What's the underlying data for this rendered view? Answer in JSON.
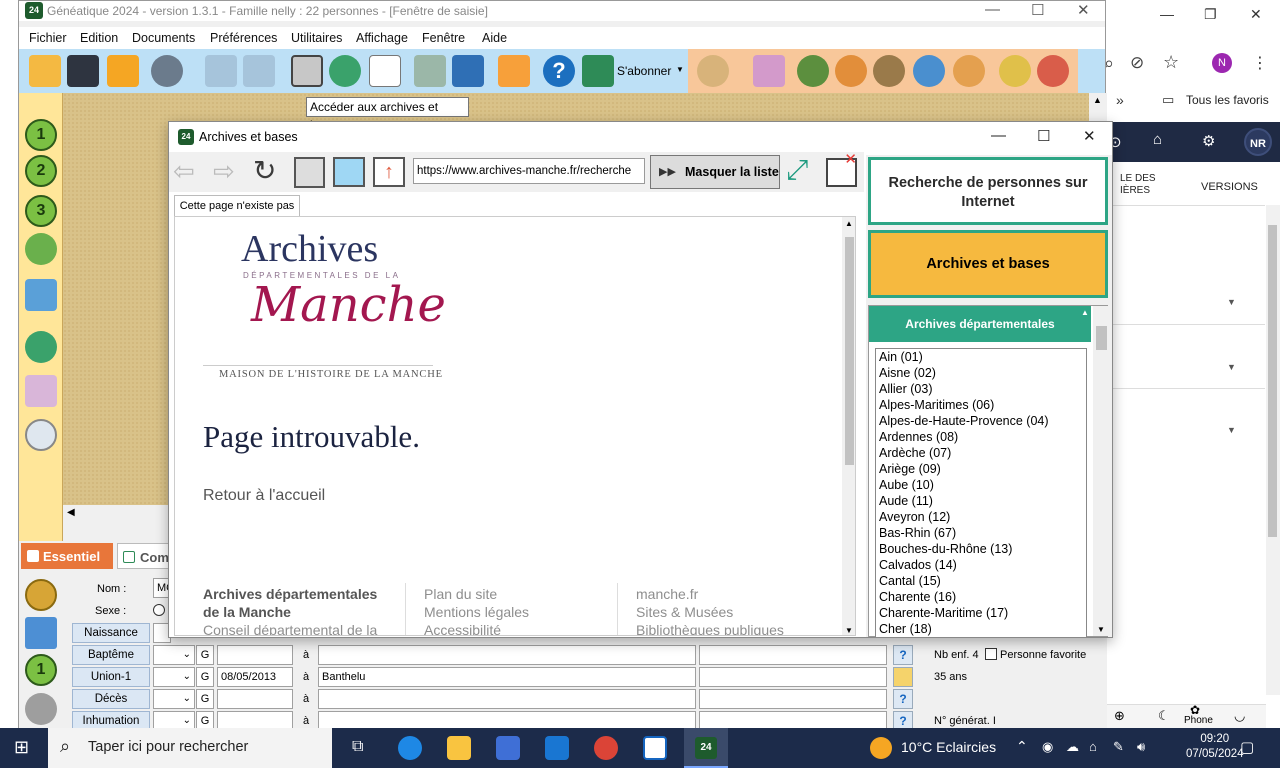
{
  "app": {
    "title": "Généatique 2024 - version 1.3.1 - Famille nelly : 22 personnes - [Fenêtre de saisie]",
    "logo": "24",
    "menu": [
      "Fichier",
      "Edition",
      "Documents",
      "Préférences",
      "Utilitaires",
      "Affichage",
      "Fenêtre",
      "Aide"
    ],
    "toolbar_label": "S'abonner",
    "tooltip": "Accéder aux archives et bases",
    "accent": "#2da585"
  },
  "form": {
    "tabs": [
      "Essentiel",
      "Com"
    ],
    "nom_label": "Nom :",
    "nom_value": "MO",
    "sexe_label": "Sexe :",
    "events": [
      {
        "label": "Naissance",
        "g": "",
        "date": "",
        "a": "",
        "place": ""
      },
      {
        "label": "Baptême",
        "g": "G",
        "date": "",
        "a": "à",
        "place": ""
      },
      {
        "label": "Union-1",
        "g": "G",
        "date": "08/05/2013",
        "a": "à",
        "place": "Banthelu"
      },
      {
        "label": "Décès",
        "g": "G",
        "date": "",
        "a": "à",
        "place": ""
      },
      {
        "label": "Inhumation",
        "g": "G",
        "date": "",
        "a": "à",
        "place": ""
      }
    ],
    "nb_enf": "Nb enf. 4",
    "favorite": "Personne favorite",
    "age": "35 ans",
    "generation": "N° générat. I"
  },
  "dialog": {
    "title": "Archives et bases",
    "url": "https://www.archives-manche.fr/recherche",
    "masquer": "Masquer la liste",
    "page_tab": "Cette page n'existe pas",
    "web": {
      "archives": "Archives",
      "departementales": "DÉPARTEMENTALES DE LA",
      "manche": "Manche",
      "maison": "MAISON DE L'HISTOIRE DE LA MANCHE",
      "heading": "Page introuvable.",
      "retour": "Retour à l'accueil",
      "footer_col1": [
        "Archives départementales",
        "de la Manche",
        "Conseil départemental de la"
      ],
      "footer_col2": [
        "Plan du site",
        "Mentions légales",
        "Accessibilité"
      ],
      "footer_col3": [
        "manche.fr",
        "Sites & Musées",
        "Bibliothèques publiques"
      ]
    },
    "panel": {
      "search_btn": "Recherche de personnes sur Internet",
      "archives_btn": "Archives et bases",
      "list_header": "Archives départementales",
      "items": [
        "Ain (01)",
        "Aisne (02)",
        "Allier (03)",
        "Alpes-Maritimes (06)",
        "Alpes-de-Haute-Provence (04)",
        "Ardennes (08)",
        "Ardèche (07)",
        "Ariège (09)",
        "Aube (10)",
        "Aude (11)",
        "Aveyron (12)",
        "Bas-Rhin (67)",
        "Bouches-du-Rhône (13)",
        "Calvados (14)",
        "Cantal (15)",
        "Charente (16)",
        "Charente-Maritime (17)",
        "Cher (18)"
      ]
    }
  },
  "browser": {
    "favorites": "Tous les favoris",
    "avatar": "NR",
    "profile": "N",
    "tab1": "LE DES",
    "tab1b": "IÈRES",
    "versions": "VERSIONS",
    "phone": "Phone"
  },
  "taskbar": {
    "search": "Taper ici pour rechercher",
    "weather": "10°C  Eclaircies",
    "time": "09:20",
    "date": "07/05/2024"
  }
}
